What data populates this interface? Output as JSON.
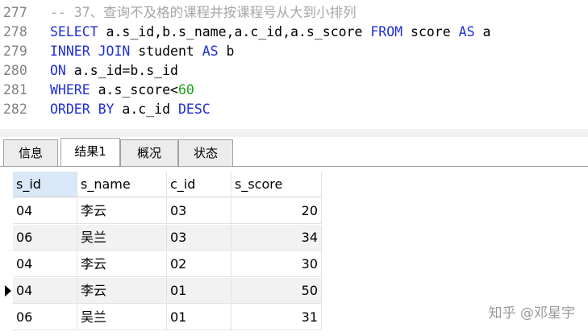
{
  "editor": {
    "lines": [
      {
        "num": "277",
        "parts": [
          {
            "t": "-- 37、查询不及格的课程并按课程号从大到小排列",
            "c": "cm"
          }
        ]
      },
      {
        "num": "278",
        "parts": [
          {
            "t": "SELECT",
            "c": "kw"
          },
          {
            "t": " a.s_id,b.s_name,a.c_id,a.s_score ",
            "c": "tx"
          },
          {
            "t": "FROM",
            "c": "kw"
          },
          {
            "t": " score ",
            "c": "tx"
          },
          {
            "t": "AS",
            "c": "kw"
          },
          {
            "t": " a",
            "c": "tx"
          }
        ]
      },
      {
        "num": "279",
        "parts": [
          {
            "t": "INNER JOIN",
            "c": "kw"
          },
          {
            "t": " student ",
            "c": "tx"
          },
          {
            "t": "AS",
            "c": "kw"
          },
          {
            "t": " b",
            "c": "tx"
          }
        ]
      },
      {
        "num": "280",
        "parts": [
          {
            "t": "ON",
            "c": "kw"
          },
          {
            "t": " a.s_id=b.s_id",
            "c": "tx"
          }
        ]
      },
      {
        "num": "281",
        "parts": [
          {
            "t": "WHERE",
            "c": "kw"
          },
          {
            "t": " a.s_score<",
            "c": "tx"
          },
          {
            "t": "60",
            "c": "num"
          }
        ]
      },
      {
        "num": "282",
        "parts": [
          {
            "t": "ORDER BY",
            "c": "kw"
          },
          {
            "t": " a.c_id ",
            "c": "tx"
          },
          {
            "t": "DESC",
            "c": "kw"
          }
        ]
      }
    ]
  },
  "tabs": [
    {
      "label": "信息",
      "active": false
    },
    {
      "label": "结果1",
      "active": true
    },
    {
      "label": "概况",
      "active": false
    },
    {
      "label": "状态",
      "active": false
    }
  ],
  "grid": {
    "columns": [
      "s_id",
      "s_name",
      "c_id",
      "s_score"
    ],
    "rows": [
      [
        "04",
        "李云",
        "03",
        "20"
      ],
      [
        "06",
        "吴兰",
        "03",
        "34"
      ],
      [
        "04",
        "李云",
        "02",
        "30"
      ],
      [
        "04",
        "李云",
        "01",
        "50"
      ],
      [
        "06",
        "吴兰",
        "01",
        "31"
      ]
    ],
    "current_row": 3
  },
  "watermark": "知乎 @邓星宇",
  "colors": {
    "keyword": "#1f2fd6",
    "comment": "#a6a6a6",
    "number": "#1aa31a"
  }
}
